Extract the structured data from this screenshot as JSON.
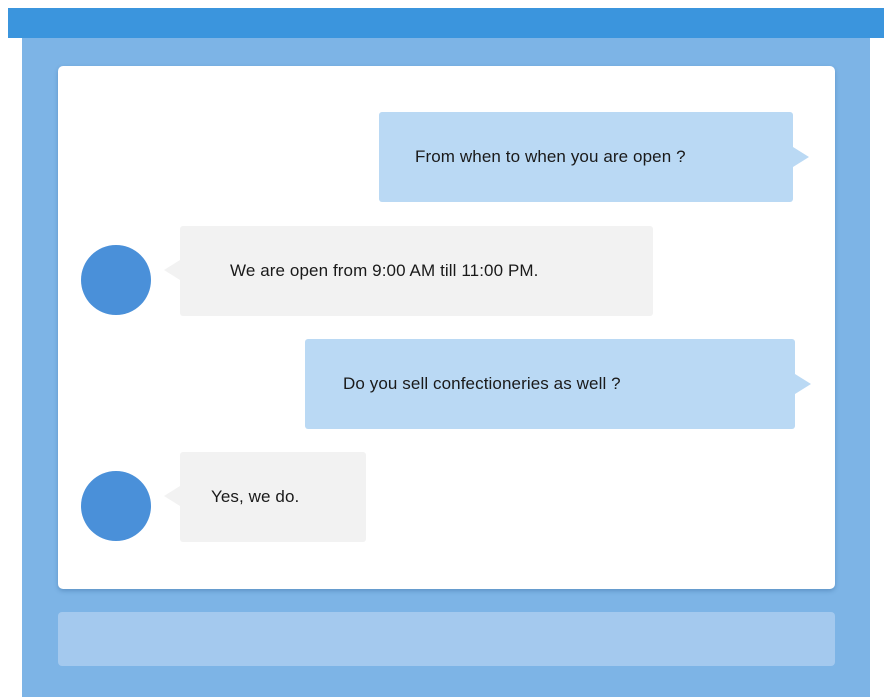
{
  "colors": {
    "title_bar": "#3b95dd",
    "window_background": "#7db4e6",
    "chat_panel": "#ffffff",
    "user_bubble": "#bad9f4",
    "bot_bubble": "#f2f2f2",
    "avatar": "#4a90d9",
    "input_bar": "#a4c9ee"
  },
  "chat": {
    "messages": [
      {
        "sender": "user",
        "text": "From when to when you are open ?"
      },
      {
        "sender": "bot",
        "text": "We are open from 9:00 AM till 11:00 PM."
      },
      {
        "sender": "user",
        "text": "Do you sell confectioneries as well ?"
      },
      {
        "sender": "bot",
        "text": "Yes, we do."
      }
    ]
  },
  "input": {
    "value": ""
  }
}
